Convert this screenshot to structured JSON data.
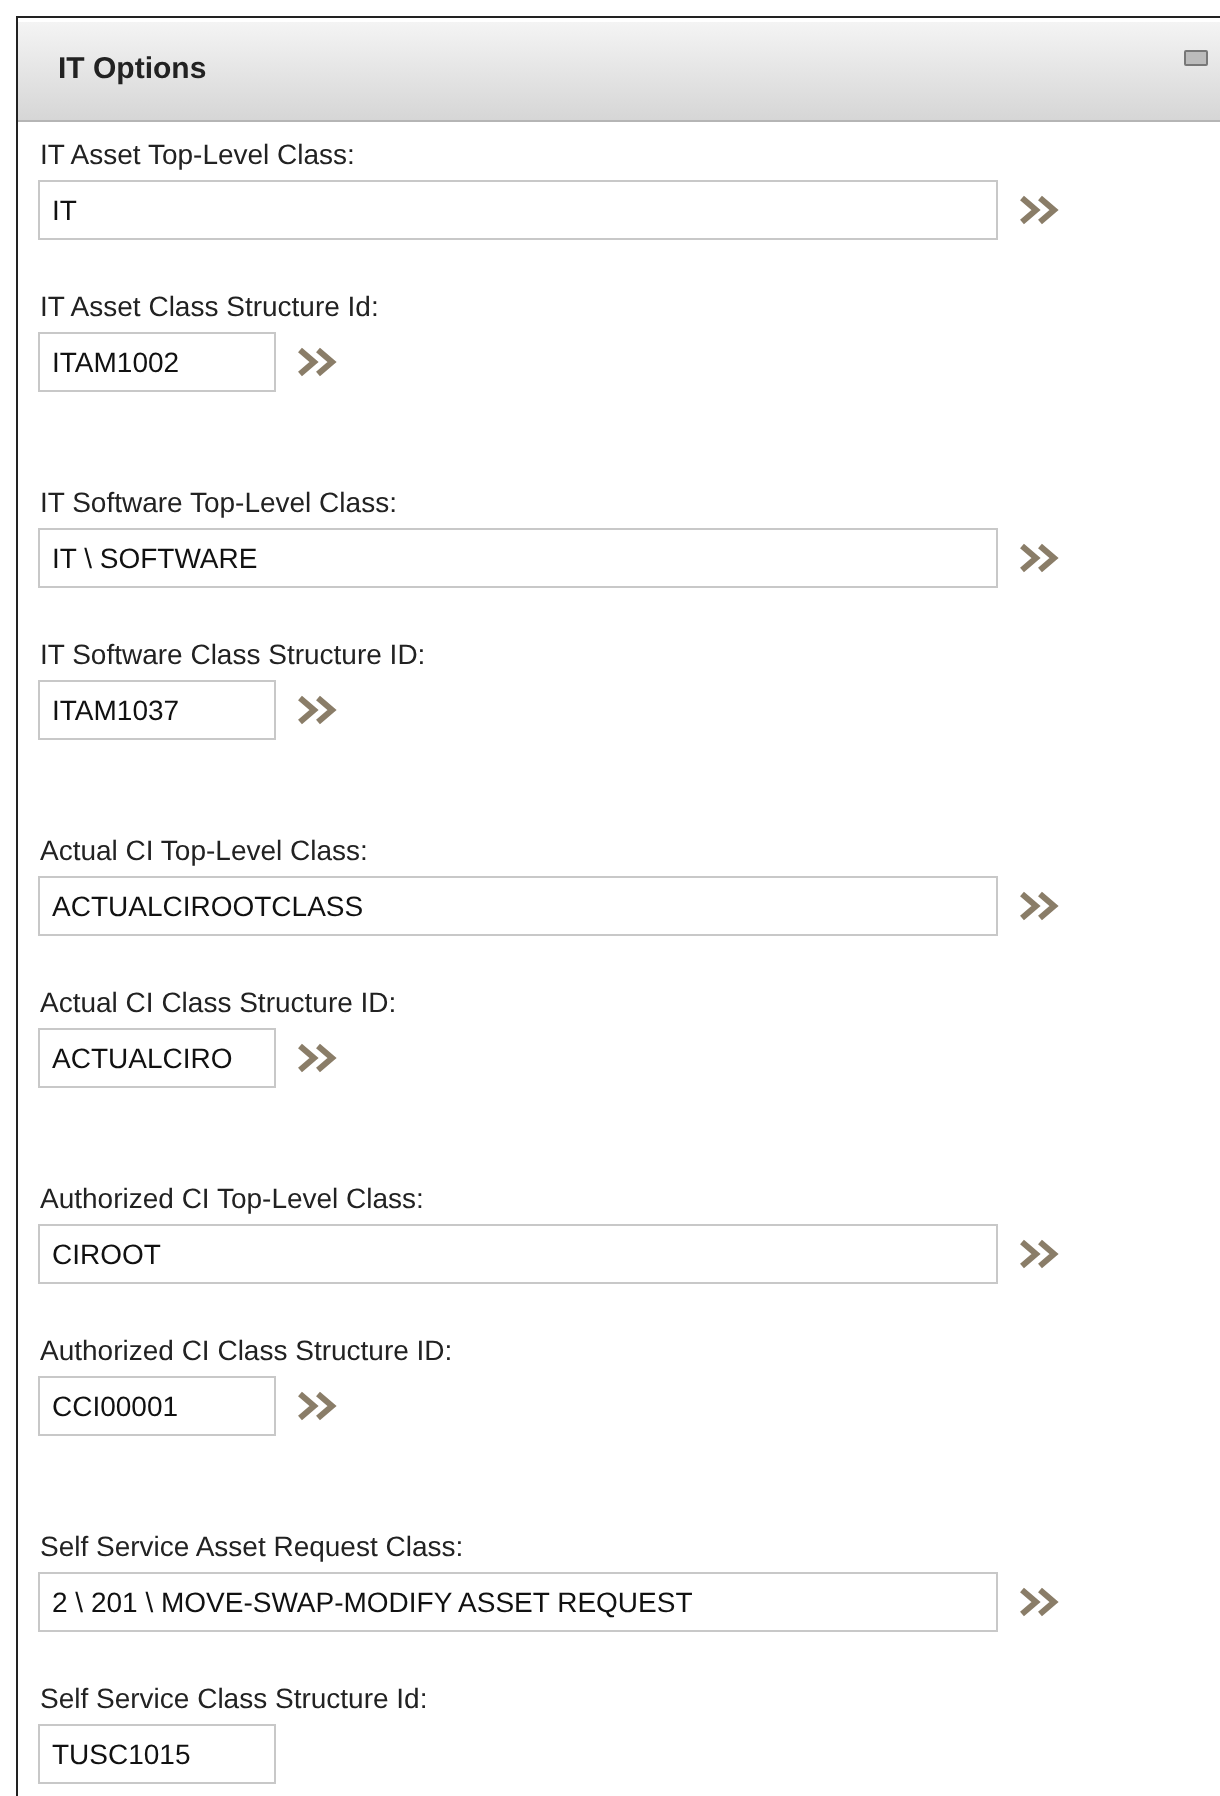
{
  "panel": {
    "title": "IT Options"
  },
  "groups": [
    {
      "fields": [
        {
          "label": "IT Asset Top-Level Class:",
          "value": "IT",
          "kind": "long",
          "lookup": true
        },
        {
          "label": "IT Asset Class Structure Id:",
          "value": "ITAM1002",
          "kind": "short",
          "lookup": true
        }
      ]
    },
    {
      "fields": [
        {
          "label": "IT Software Top-Level Class:",
          "value": "IT \\ SOFTWARE",
          "kind": "long",
          "lookup": true
        },
        {
          "label": "IT Software Class Structure ID:",
          "value": "ITAM1037",
          "kind": "short",
          "lookup": true
        }
      ]
    },
    {
      "fields": [
        {
          "label": "Actual CI Top-Level Class:",
          "value": "ACTUALCIROOTCLASS",
          "kind": "long",
          "lookup": true
        },
        {
          "label": "Actual CI Class Structure ID:",
          "value": "ACTUALCIRO",
          "kind": "short",
          "lookup": true
        }
      ]
    },
    {
      "fields": [
        {
          "label": "Authorized CI Top-Level Class:",
          "value": "CIROOT",
          "kind": "long",
          "lookup": true
        },
        {
          "label": "Authorized CI Class Structure ID:",
          "value": "CCI00001",
          "kind": "short",
          "lookup": true
        }
      ]
    },
    {
      "fields": [
        {
          "label": "Self Service Asset Request Class:",
          "value": "2 \\ 201 \\ MOVE-SWAP-MODIFY ASSET REQUEST",
          "kind": "long",
          "lookup": true
        },
        {
          "label": "Self Service Class Structure Id:",
          "value": "TUSC1015",
          "kind": "short",
          "lookup": false
        }
      ]
    }
  ]
}
